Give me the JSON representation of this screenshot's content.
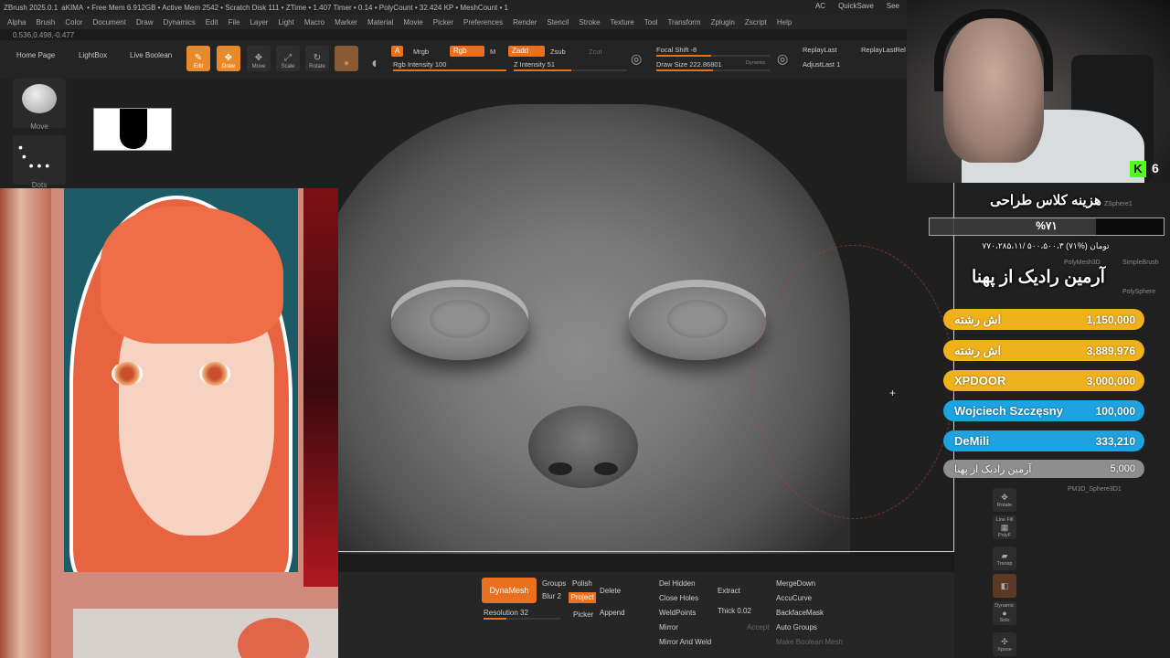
{
  "titlebar": {
    "app": "ZBrush 2025.0.1",
    "project": "aKIMA",
    "stats": "• Free Mem 6.912GB • Active Mem 2542 • Scratch Disk 111 • ZTime • 1.407 Timer • 0.14 • PolyCount • 32.424 KP • MeshCount • 1",
    "ac": "AC",
    "quicksave": "QuickSave",
    "see": "See"
  },
  "menu": [
    "Alpha",
    "Brush",
    "Color",
    "Document",
    "Draw",
    "Dynamics",
    "Edit",
    "File",
    "Layer",
    "Light",
    "Macro",
    "Marker",
    "Material",
    "Movie",
    "Picker",
    "Preferences",
    "Render",
    "Stencil",
    "Stroke",
    "Texture",
    "Tool",
    "Transform",
    "Zplugin",
    "Zscript",
    "Help"
  ],
  "coords": "0.536,0.498,-0.477",
  "toolbar": {
    "home": "Home Page",
    "lightbox": "LightBox",
    "liveboolean": "Live Boolean",
    "edit": "Edit",
    "draw": "Draw",
    "move": "Move",
    "scale": "Scale",
    "rotate": "Rotate",
    "a": "A",
    "mrgb": "Mrgb",
    "rgb": "Rgb",
    "m": "M",
    "zadd": "Zadd",
    "zsub": "Zsub",
    "zcut": "Zcut",
    "rgb_intensity": "Rgb Intensity 100",
    "z_intensity": "Z Intensity 51",
    "z_intensity_value": 0.51,
    "focal_shift": "Focal Shift -8",
    "draw_size": "Draw Size 222.86801",
    "dynamic": "Dynamic",
    "replaylast": "ReplayLast",
    "replaylastrel": "ReplayLastRel",
    "adjustlast": "AdjustLast 1"
  },
  "leftpanel": {
    "brush_label": "Move",
    "stroke_label": "Dots"
  },
  "bottom": {
    "dynamesh": "DynaMesh",
    "groups": "Groups",
    "polish": "Polish",
    "blur": "Blur 2",
    "project": "Project",
    "resolution": "Resolution 32",
    "picker": "Picker",
    "delete": "Delete",
    "append": "Append",
    "delhidden": "Del Hidden",
    "closeholes": "Close Holes",
    "weldpoints": "WeldPoints",
    "mirror": "Mirror",
    "mirrorweld": "Mirror And Weld",
    "extract": "Extract",
    "thick": "Thick 0.02",
    "accept": "Accept",
    "mergedown": "MergeDown",
    "accucurve": "AccuCurve",
    "backfacemask": "BackfaceMask",
    "autogroups": "Auto Groups",
    "makeboolean": "Make Boolean Mesh"
  },
  "rightpanel": {
    "zsphere": "ZSphere1",
    "polymesh": "PolyMesh3D",
    "simplebrush": "SimpleBrush",
    "polysphere": "PolySphere",
    "pm3d": "PM3D_Sphere3D1",
    "rotate": "Rotate",
    "linefill": "Line Fill",
    "polyf": "PolyF",
    "transp": "Transp",
    "dynamic": "Dynamic",
    "solo": "Solo",
    "xpose": "Xpose"
  },
  "stream": {
    "kick_count": "6",
    "goal_title": "هزینه کلاس طراحی",
    "goal_percent": "%۷۱",
    "goal_percent_value": 0.71,
    "goal_progress": "۷۷۰،۲۸۵،۱۱/ ۵۰۰،۵۰۰،۳ تومان (%۷۱)",
    "top_donor_title": "آرمین رادیک از پهنا",
    "donations": [
      {
        "name": "اش رشته",
        "amount": "1,150,000",
        "color": "#f0b21c"
      },
      {
        "name": "اش رشته",
        "amount": "3,889,976",
        "color": "#f0b21c"
      },
      {
        "name": "XPDOOR",
        "amount": "3,000,000",
        "color": "#f0b21c"
      },
      {
        "name": "Wojciech Szczęsny",
        "amount": "100,000",
        "color": "#1ea3e0"
      },
      {
        "name": "DeMili",
        "amount": "333,210",
        "color": "#1ea3e0"
      },
      {
        "name": "آرمین رادیک از پهنا",
        "amount": "5,000",
        "color": "#8e8e8e"
      }
    ]
  },
  "colors": {
    "accent": "#e8701f",
    "canvas": "#1f1f1f"
  }
}
